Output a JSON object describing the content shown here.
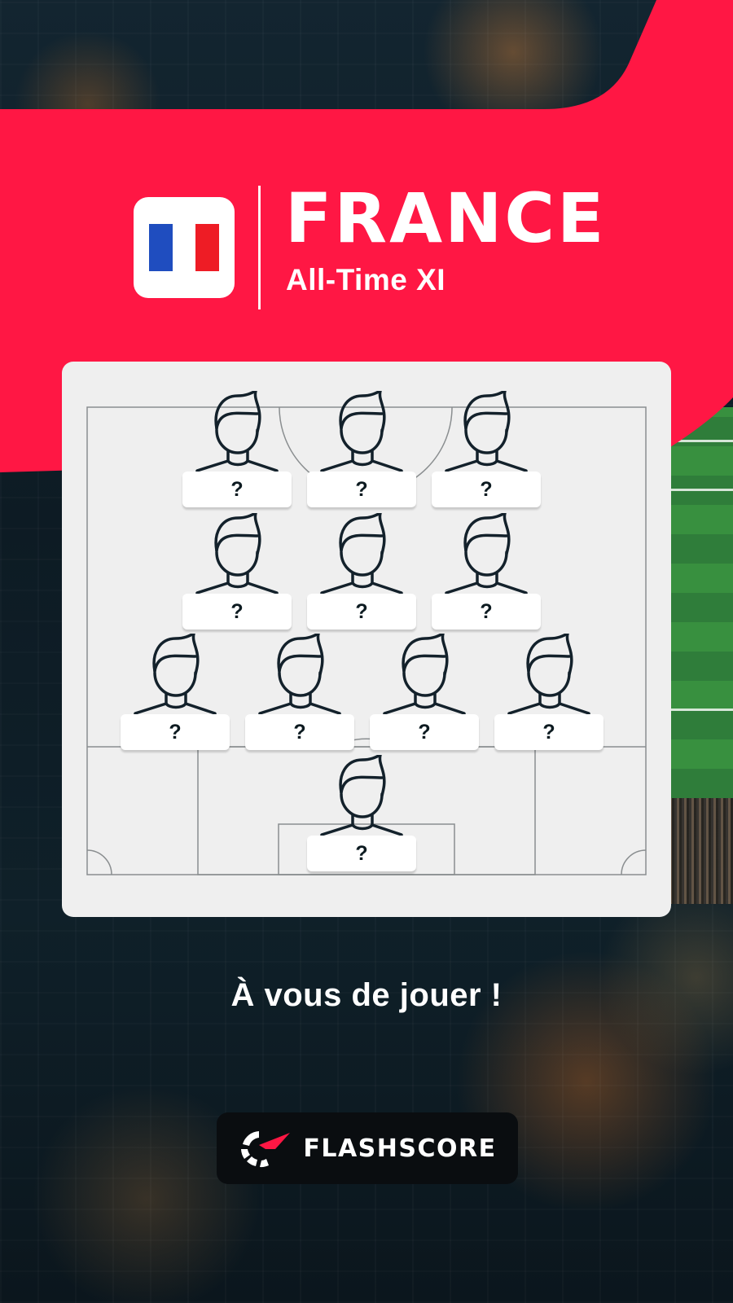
{
  "header": {
    "title": "FRANCE",
    "subtitle": "All-Time XI",
    "flag_icon": "france-flag-icon",
    "flag_colors": [
      "#1f4dbf",
      "#ffffff",
      "#ee1c25"
    ]
  },
  "colors": {
    "accent": "#ff1744",
    "card": "#efefef",
    "text_dark": "#0c1a20"
  },
  "lineup": {
    "rows": [
      [
        "?",
        "?",
        "?"
      ],
      [
        "?",
        "?",
        "?"
      ],
      [
        "?",
        "?",
        "?",
        "?"
      ],
      [
        "?"
      ]
    ]
  },
  "cta": "À vous de jouer !",
  "brand": {
    "name": "FLASHSCORE",
    "logo_icon": "flashscore-logo-icon"
  }
}
